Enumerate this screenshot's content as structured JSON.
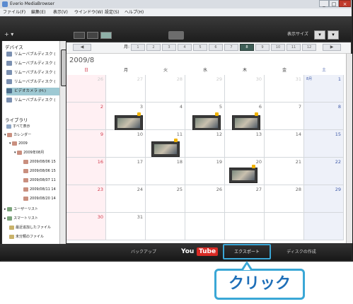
{
  "window": {
    "title": "Everio MediaBrowser",
    "ctrl_min": "_",
    "ctrl_max": "□",
    "ctrl_close": "×"
  },
  "menu": [
    "ファイル(F)",
    "編集(E)",
    "表示(V)",
    "ウインドウ(W)",
    "設定(S)",
    "ヘルプ(H)"
  ],
  "toolbar": {
    "add_label": "+ ▾",
    "display_label": "表示サイズ",
    "disp_btn1": "▾",
    "disp_btn2": "▾"
  },
  "sidebar": {
    "devices_title": "デバイス",
    "devices": [
      "リムーバブルディスク (",
      "リムーバブルディスク (",
      "リムーバブルディスク (",
      "リムーバブルディスク (",
      "ビデオカメラ (H:)",
      "リムーバブルディスク ("
    ],
    "library_title": "ライブラリ",
    "library": [
      "すべて表示",
      "カレンダー",
      "2009",
      "2009年08月",
      "2009/08/06 15",
      "2009/08/06 15",
      "2009/08/07 11",
      "2009/08/11 14",
      "2009/08/20 14",
      "ユーザーリスト",
      "スマートリスト",
      "最近追加したファイル",
      "未分類のファイル"
    ]
  },
  "monthbar": {
    "prev": "◀",
    "next": "▶",
    "label": "月:",
    "months": [
      "1",
      "2",
      "3",
      "4",
      "5",
      "6",
      "7",
      "8",
      "9",
      "10",
      "11",
      "12"
    ],
    "active_month": "8"
  },
  "calendar": {
    "title": "2009/8",
    "days_of_week": [
      "日",
      "月",
      "火",
      "水",
      "木",
      "金",
      "土"
    ],
    "weeks": [
      [
        "26",
        "27",
        "28",
        "29",
        "30",
        "31",
        "1"
      ],
      [
        "2",
        "3",
        "4",
        "5",
        "6",
        "7",
        "8"
      ],
      [
        "9",
        "10",
        "11",
        "12",
        "13",
        "14",
        "15"
      ],
      [
        "16",
        "17",
        "18",
        "19",
        "20",
        "21",
        "22"
      ],
      [
        "23",
        "24",
        "25",
        "26",
        "27",
        "28",
        "29"
      ],
      [
        "30",
        "31",
        "",
        "",
        "",
        "",
        ""
      ]
    ],
    "sat_first_extra": "8月"
  },
  "bottom": {
    "backup": "バックアップ",
    "youtube_you": "You",
    "youtube_tube": "Tube",
    "export": "エクスポート",
    "disc": "ディスクの作成"
  },
  "callout": {
    "text": "クリック"
  }
}
